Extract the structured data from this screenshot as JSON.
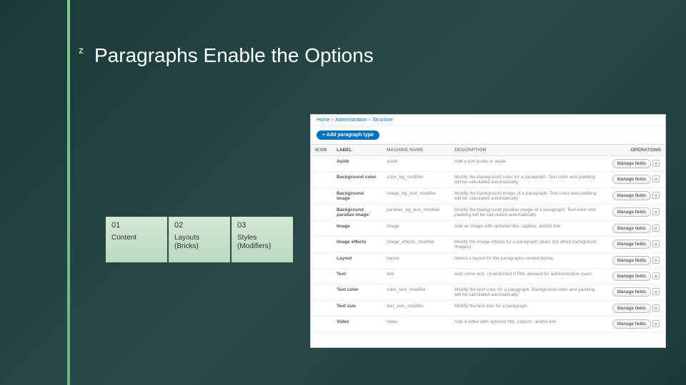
{
  "title": "Paragraphs Enable the Options",
  "icon": "z",
  "cards": [
    {
      "num": "01",
      "label": "Content"
    },
    {
      "num": "02",
      "label": "Layouts (Bricks)"
    },
    {
      "num": "03",
      "label": "Styles (Modifiers)"
    }
  ],
  "screenshot": {
    "breadcrumb": {
      "home": "Home",
      "sep": " » ",
      "admin": "Administration",
      "struct": "Structure"
    },
    "add_button": "+ Add paragraph type",
    "headers": {
      "icon": "ICON",
      "label": "LABEL",
      "mname": "MACHINE NAME",
      "desc": "DESCRIPTION",
      "ops": "OPERATIONS"
    },
    "manage_label": "Manage fields",
    "rows": [
      {
        "label": "Aside",
        "mname": "aside",
        "desc": "Add a pull quote or aside."
      },
      {
        "label": "Background color",
        "mname": "color_bg_modifier",
        "desc": "Modify the background color for a paragraph. Text color and padding will be calculated automatically."
      },
      {
        "label": "Background image",
        "mname": "image_bg_text_modifier",
        "desc": "Modify the background image of a paragraph. Text color and padding will be calculated automatically."
      },
      {
        "label": "Background parallax image",
        "mname": "parallax_bg_text_modifier",
        "desc": "Modify the background parallax image of a paragraph. Text color and padding will be calculated automatically."
      },
      {
        "label": "Image",
        "mname": "image",
        "desc": "Add an image with optional title, caption, and/or link."
      },
      {
        "label": "Image effects",
        "mname": "image_effects_modifier",
        "desc": "Modify the image effects for a paragraph (does not affect background images)."
      },
      {
        "label": "Layout",
        "mname": "layout",
        "desc": "Select a layout for the paragraphs nested below."
      },
      {
        "label": "Text",
        "mname": "text",
        "desc": "Add some text. Unrestricted HTML allowed for administrative users."
      },
      {
        "label": "Text color",
        "mname": "color_text_modifier",
        "desc": "Modify the text color for a paragraph. Background color and padding will be calculated automatically."
      },
      {
        "label": "Text size",
        "mname": "text_size_modifier",
        "desc": "Modify the text size for a paragraph."
      },
      {
        "label": "Video",
        "mname": "video",
        "desc": "Add a video with optional title, caption, and/or link."
      }
    ]
  }
}
